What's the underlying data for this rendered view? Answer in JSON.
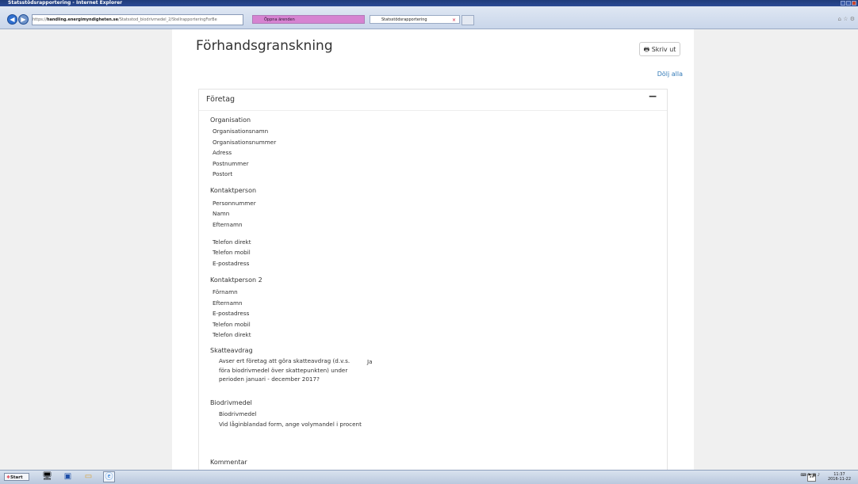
{
  "window": {
    "title": "Statsstödsrapportering - Internet Explorer"
  },
  "browser": {
    "url_scheme": "https://",
    "url_domain": "handling.energimyndigheten.se",
    "url_path": "/Statsstod_biodrivmedel_2/StellrapporteringForBe",
    "tabs": [
      {
        "label": "Öppna ärenden"
      },
      {
        "label": "Statsstödsrapportering"
      }
    ],
    "tab_close": "×"
  },
  "page": {
    "title": "Förhandsgranskning",
    "print_label": "Skriv ut",
    "hide_all_label": "Dölj alla",
    "panel_title": "Företag",
    "collapse_symbol": "−"
  },
  "sections": {
    "organisation": {
      "title": "Organisation",
      "fields": [
        "Organisationsnamn",
        "Organisationsnummer",
        "Adress",
        "Postnummer",
        "Postort"
      ]
    },
    "contact": {
      "title": "Kontaktperson",
      "fields": [
        "Personnummer",
        "Namn",
        "Efternamn",
        "Telefon direkt",
        "Telefon mobil",
        "E-postadress"
      ]
    },
    "contact2": {
      "title": "Kontaktperson 2",
      "fields": [
        "Förnamn",
        "Efternamn",
        "E-postadress",
        "Telefon mobil",
        "Telefon direkt"
      ]
    },
    "tax": {
      "title": "Skatteavdrag",
      "question": "Avser ert företag att göra skatteavdrag (d.v.s. föra biodrivmedel över skattepunkten) under perioden januari - december 2017?",
      "answer": "Ja"
    },
    "bio": {
      "title": "Biodrivmedel",
      "fields": [
        "Biodrivmedel",
        "Vid låginblandad form, ange volymandel i procent"
      ]
    },
    "comment": {
      "title": "Kommentar"
    }
  },
  "taskbar": {
    "start_label": "Start",
    "lang": "SV",
    "time": "11:37",
    "date": "2016-11-22"
  }
}
